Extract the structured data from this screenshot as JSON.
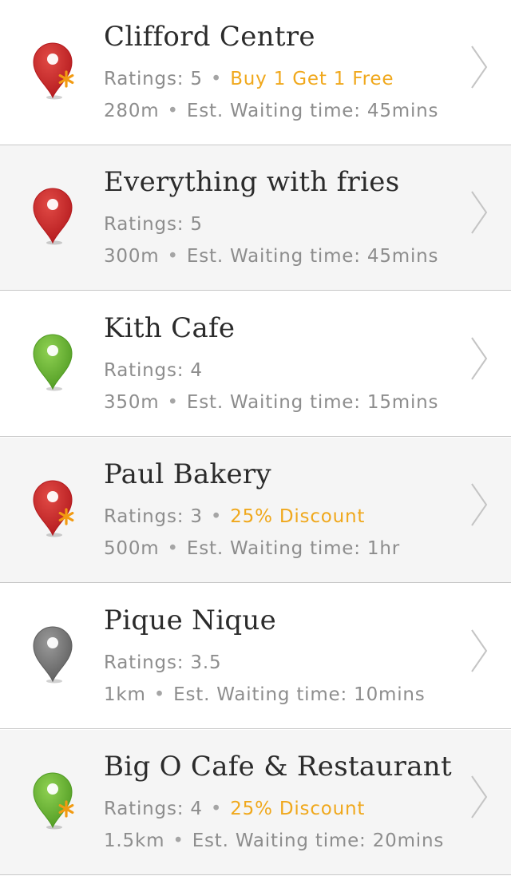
{
  "colors": {
    "pin_red": "#c8272b",
    "pin_green": "#6fb33b",
    "pin_grey": "#7a7a7a",
    "promo": "#f0a81c",
    "text_primary": "#2b2b2b",
    "text_secondary": "#8d8d8d"
  },
  "icons": {
    "pin": "map-pin-icon",
    "promo_star": "asterisk-icon",
    "chevron": "chevron-right-icon"
  },
  "items": [
    {
      "name": "Clifford Centre",
      "ratings": "Ratings: 5",
      "promo": "Buy 1 Get 1 Free",
      "distance": "280m",
      "waiting": "Est. Waiting time: 45mins",
      "pin_color": "red",
      "has_promo": true
    },
    {
      "name": "Everything with fries",
      "ratings": "Ratings: 5",
      "promo": "",
      "distance": "300m",
      "waiting": "Est. Waiting time: 45mins",
      "pin_color": "red",
      "has_promo": false
    },
    {
      "name": "Kith Cafe",
      "ratings": "Ratings: 4",
      "promo": "",
      "distance": "350m",
      "waiting": "Est. Waiting time: 15mins",
      "pin_color": "green",
      "has_promo": false
    },
    {
      "name": "Paul Bakery",
      "ratings": "Ratings: 3",
      "promo": "25% Discount",
      "distance": "500m",
      "waiting": "Est. Waiting time: 1hr",
      "pin_color": "red",
      "has_promo": true
    },
    {
      "name": "Pique Nique",
      "ratings": "Ratings: 3.5",
      "promo": "",
      "distance": "1km",
      "waiting": "Est. Waiting time: 10mins",
      "pin_color": "grey",
      "has_promo": false
    },
    {
      "name": "Big O Cafe & Restaurant",
      "ratings": "Ratings: 4",
      "promo": "25% Discount",
      "distance": "1.5km",
      "waiting": "Est. Waiting time: 20mins",
      "pin_color": "green",
      "has_promo": true
    }
  ]
}
